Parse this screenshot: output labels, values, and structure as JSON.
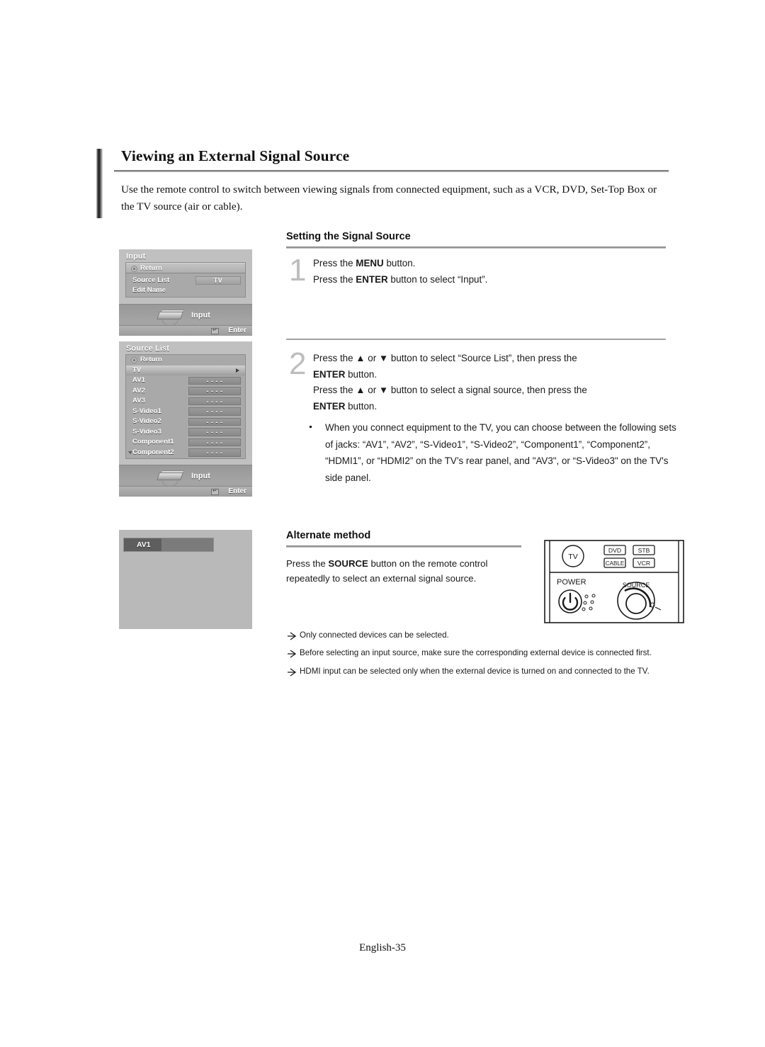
{
  "page": {
    "title": "Viewing an External Signal Source",
    "intro": "Use the remote control to switch between viewing signals from connected equipment, such as a VCR, DVD, Set-Top Box or the TV source (air or cable).",
    "footer": "English-35"
  },
  "osd_input": {
    "title": "Input",
    "rows": [
      {
        "label": "Return",
        "value": ""
      },
      {
        "label": "Source List",
        "value": "TV"
      },
      {
        "label": "Edit Name",
        "value": ""
      }
    ],
    "footer_label": "Input",
    "enter_label": "Enter",
    "device_icon": "set-top-box-icon",
    "return_icon": "return-icon",
    "enter_icon": "enter-key-icon"
  },
  "osd_source_list": {
    "title": "Source List",
    "rows": [
      {
        "label": "Return",
        "value": ""
      },
      {
        "label": "TV",
        "value": ""
      },
      {
        "label": "AV1",
        "value": "- - - -"
      },
      {
        "label": "AV2",
        "value": "- - - -"
      },
      {
        "label": "AV3",
        "value": "- - - -"
      },
      {
        "label": "S-Video1",
        "value": "- - - -"
      },
      {
        "label": "S-Video2",
        "value": "- - - -"
      },
      {
        "label": "S-Video3",
        "value": "- - - -"
      },
      {
        "label": "Component1",
        "value": "- - - -"
      },
      {
        "label": "Component2",
        "value": "- - - -"
      }
    ],
    "footer_label": "Input",
    "enter_label": "Enter",
    "scroll_down_icon": "chevron-down-icon",
    "submenu_arrow_icon": "chevron-right-icon"
  },
  "av_preview": {
    "label": "AV1"
  },
  "setting_section": {
    "heading": "Setting the Signal Source",
    "step1": {
      "number": "1",
      "line1_a": "Press the ",
      "line1_b": "MENU",
      "line1_c": " button.",
      "line2_a": "Press the ",
      "line2_b": "ENTER",
      "line2_c": " button to select “Input”."
    },
    "step2": {
      "number": "2",
      "l1_a": "Press the ",
      "l1_up": "▲",
      "l1_b": " or ",
      "l1_dn": "▼",
      "l1_c": " button to select “Source List”, then press the",
      "l2_b": "ENTER",
      "l2_c": " button.",
      "l3_a": "Press the ",
      "l3_up": "▲",
      "l3_b": " or ",
      "l3_dn": "▼",
      "l3_c": " button to select a signal source, then press the",
      "l4_b": "ENTER",
      "l4_c": " button."
    },
    "bullet": "When you connect equipment to the TV, you can choose between the following sets of jacks: “AV1”, “AV2”, “S-Video1”, “S-Video2”, “Component1”, “Component2”, “HDMI1”, or “HDMI2” on the TV’s rear panel, and \"AV3\", or “S-Video3\" on the TV's side panel."
  },
  "alternate_section": {
    "heading": "Alternate method",
    "line1_a": "Press the ",
    "line1_b": "SOURCE",
    "line1_c": " button on the remote control",
    "line2": "repeatedly to select an external signal source."
  },
  "remote": {
    "tv_button": "TV",
    "dvd_button": "DVD",
    "stb_button": "STB",
    "cable_button": "CABLE",
    "vcr_button": "VCR",
    "power_label": "POWER",
    "source_label": "SOURCE",
    "power_icon": "power-icon",
    "source_dial_icon": "source-dial-icon"
  },
  "notes": [
    "Only connected devices can be selected.",
    "Before selecting an input source, make sure the corresponding external device is connected first.",
    "HDMI input can be selected only when the external device is turned on and connected to the TV."
  ],
  "note_icon": "arrow-note-icon"
}
